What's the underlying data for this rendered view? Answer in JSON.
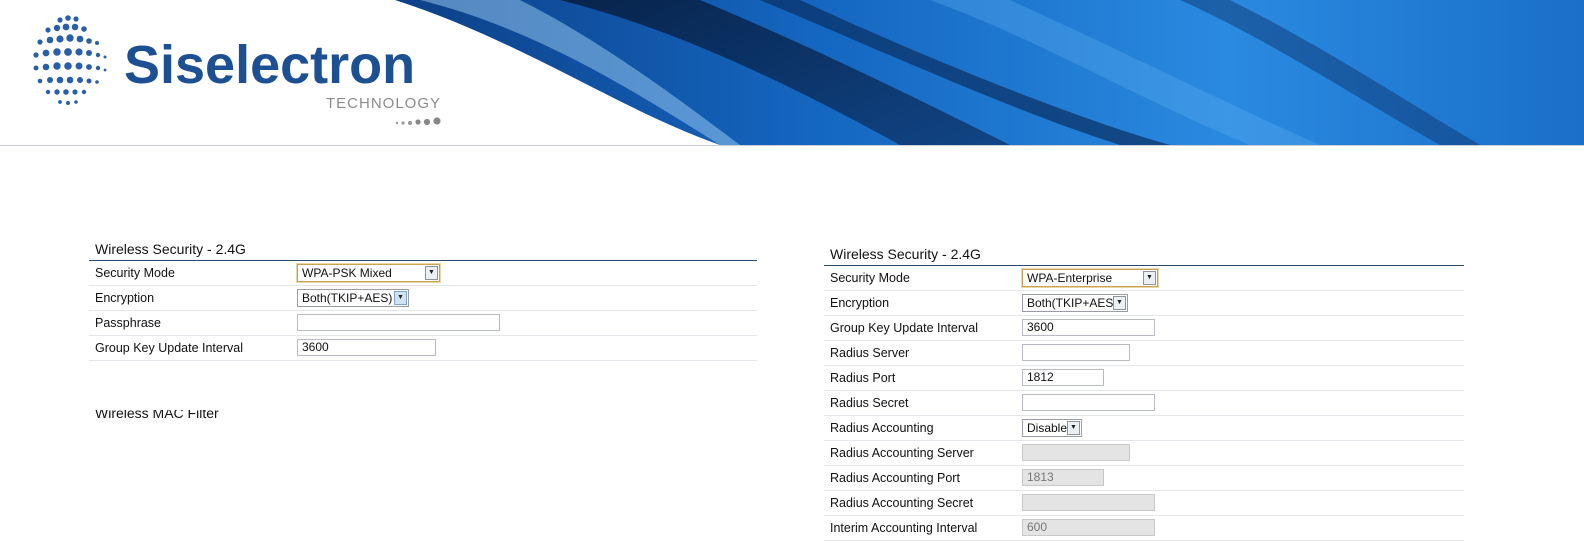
{
  "header": {
    "brand_name": "Siselectron",
    "tagline": "TECHNOLOGY",
    "colors": {
      "brand": "#1d4f93",
      "banner_blue": "#1a6fc4",
      "banner_dark": "#0b2a55"
    }
  },
  "left_panel": {
    "title": "Wireless Security - 2.4G",
    "rows": {
      "security_mode": {
        "label": "Security Mode",
        "value": "WPA-PSK Mixed"
      },
      "encryption": {
        "label": "Encryption",
        "value": "Both(TKIP+AES)"
      },
      "passphrase": {
        "label": "Passphrase",
        "value": ""
      },
      "group_key": {
        "label": "Group Key Update Interval",
        "value": "3600"
      }
    },
    "next_section_title": "Wireless MAC Filter"
  },
  "right_panel": {
    "title": "Wireless Security - 2.4G",
    "rows": {
      "security_mode": {
        "label": "Security Mode",
        "value": "WPA-Enterprise"
      },
      "encryption": {
        "label": "Encryption",
        "value": "Both(TKIP+AES)"
      },
      "group_key": {
        "label": "Group Key Update Interval",
        "value": "3600"
      },
      "radius_server": {
        "label": "Radius Server",
        "value": ""
      },
      "radius_port": {
        "label": "Radius Port",
        "value": "1812"
      },
      "radius_secret": {
        "label": "Radius Secret",
        "value": ""
      },
      "radius_accounting": {
        "label": "Radius Accounting",
        "value": "Disable"
      },
      "radius_accounting_server": {
        "label": "Radius Accounting Server",
        "value": ""
      },
      "radius_accounting_port": {
        "label": "Radius Accounting Port",
        "value": "1813"
      },
      "radius_accounting_secret": {
        "label": "Radius Accounting Secret",
        "value": ""
      },
      "interim_interval": {
        "label": "Interim Accounting Interval",
        "value": "600"
      }
    }
  }
}
